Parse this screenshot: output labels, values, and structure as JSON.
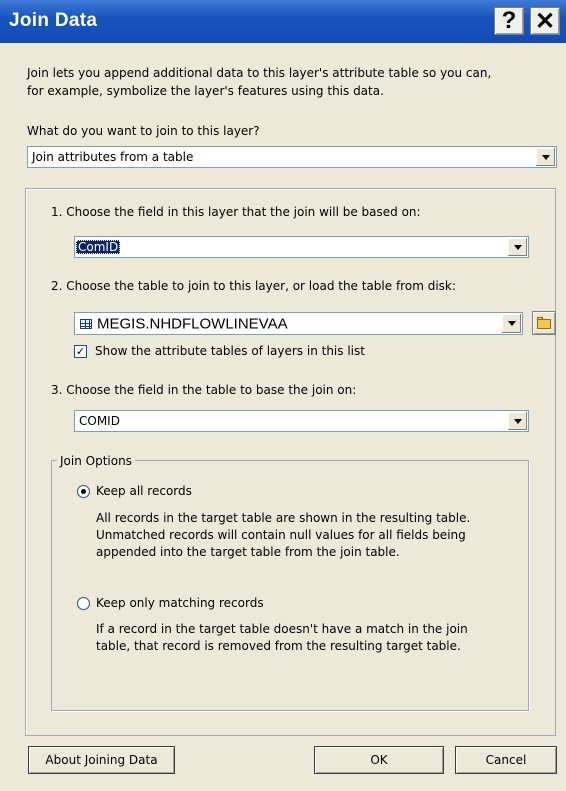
{
  "window": {
    "title": "Join Data",
    "help_label": "?",
    "close_label": "✕"
  },
  "intro": {
    "line1": "Join lets you append additional data to this layer's attribute table so you can,",
    "line2": "for example, symbolize the layer's features using this data."
  },
  "join_type": {
    "question": "What do you want to join to this layer?",
    "selected": "Join attributes from a table"
  },
  "step1": {
    "label": "1.  Choose the field in this layer that the join will be based on:",
    "selected": "ComID"
  },
  "step2": {
    "label": "2.  Choose the table to join to this layer, or load the table from disk:",
    "selected": "MEGIS.NHDFLOWLINEVAA",
    "checkbox_label": "Show the attribute tables of layers in this list",
    "checkbox_checked": true
  },
  "step3": {
    "label": "3.  Choose the field in the table to base the join on:",
    "selected": "COMID"
  },
  "join_options": {
    "legend": "Join Options",
    "keep_all": {
      "label": "Keep all records",
      "checked": true,
      "desc_line1": "All records in the target table are shown in the resulting table.",
      "desc_line2": "Unmatched records will contain null values for all fields being",
      "desc_line3": "appended into the target table from the join table."
    },
    "keep_matching": {
      "label": "Keep only matching records",
      "checked": false,
      "desc_line1": "If a record in the target table doesn't have a match in the join",
      "desc_line2": "table, that record is removed from the resulting target table."
    }
  },
  "buttons": {
    "about": "About Joining Data",
    "ok": "OK",
    "cancel": "Cancel"
  },
  "colors": {
    "titlebar": "#1a55bf",
    "dialog_bg": "#ece9d8",
    "selection": "#0a246a"
  },
  "icons": {
    "table": "table-icon",
    "folder": "open-folder-icon",
    "dropdown": "chevron-down-icon"
  }
}
